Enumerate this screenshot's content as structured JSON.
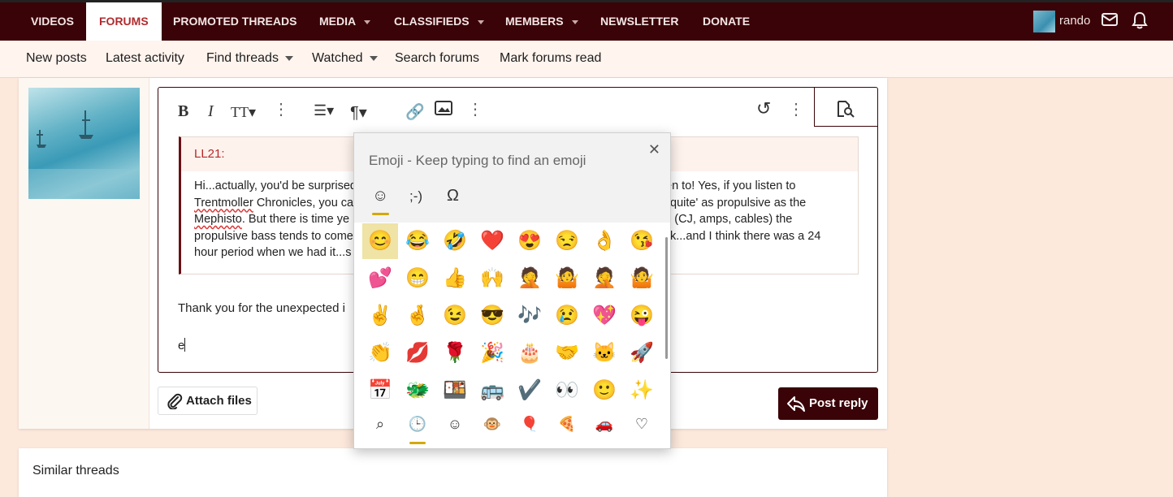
{
  "topnav": {
    "items": [
      {
        "label": "VIDEOS"
      },
      {
        "label": "FORUMS"
      },
      {
        "label": "PROMOTED THREADS"
      },
      {
        "label": "MEDIA"
      },
      {
        "label": "CLASSIFIEDS"
      },
      {
        "label": "MEMBERS"
      },
      {
        "label": "NEWSLETTER"
      },
      {
        "label": "DONATE"
      }
    ],
    "username": "rando"
  },
  "subnav": {
    "items": [
      {
        "label": "New posts"
      },
      {
        "label": "Latest activity"
      },
      {
        "label": "Find threads"
      },
      {
        "label": "Watched"
      },
      {
        "label": "Search forums"
      },
      {
        "label": "Mark forums read"
      }
    ]
  },
  "editor": {
    "quote_author": "LL21:",
    "quote_lines": [
      "Hi...actually, you'd be surprised",
      "ten to!  Yes, if you listen to",
      "Trentmoller",
      " Chronicles, you ca",
      "quite' as propulsive as the",
      "Mephisto",
      ".  But there is time ye",
      "s (CJ, amps, cables) the",
      "propulsive bass tends to come",
      "k...and I think there was a 24",
      "hour period when we had it...s"
    ],
    "reply_text": "Thank you for the unexpected i",
    "typed_text": "e"
  },
  "buttons": {
    "attach": "Attach files",
    "post": "Post reply"
  },
  "similar": {
    "title": "Similar threads"
  },
  "emoji_panel": {
    "title": "Emoji - Keep typing to find an emoji",
    "tabs": [
      "☺",
      ";-)",
      "Ω"
    ],
    "rows": [
      [
        "😊",
        "😂",
        "🤣",
        "❤️",
        "😍",
        "😒",
        "👌",
        "😘"
      ],
      [
        "💕",
        "😁",
        "👍",
        "🙌",
        "🤦",
        "🤷",
        "🤦",
        "🤷"
      ],
      [
        "✌️",
        "🤞",
        "😉",
        "😎",
        "🎶",
        "😢",
        "💖",
        "😜"
      ],
      [
        "👏",
        "💋",
        "🌹",
        "🎉",
        "🎂",
        "🤝",
        "🐱",
        "🚀"
      ],
      [
        "📅",
        "🐲",
        "🍱",
        "🚌",
        "✔️",
        "👀",
        "🙂",
        "✨"
      ]
    ],
    "cats": [
      "⌕",
      "🕒",
      "☺",
      "🐵",
      "🎈",
      "🍕",
      "🚗",
      "♡"
    ]
  },
  "colors": {
    "brand": "#3a0307",
    "accent": "#b02b2f",
    "highlight": "#efe3a6",
    "underline_gold": "#d4a800"
  }
}
